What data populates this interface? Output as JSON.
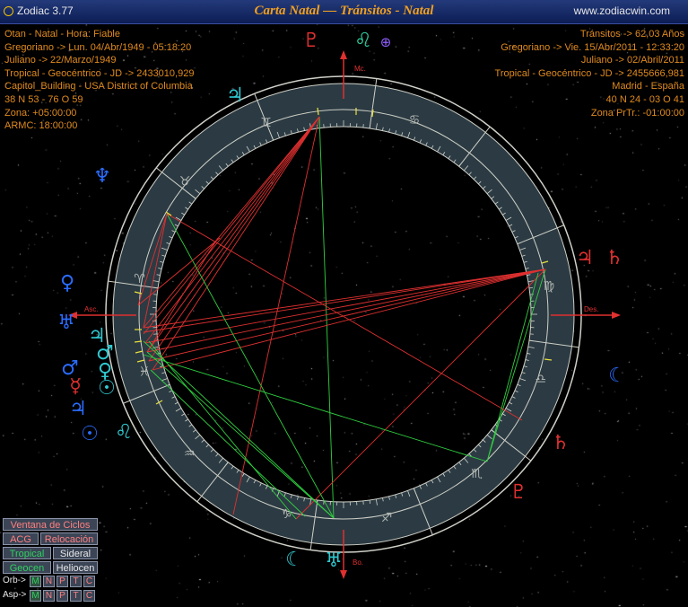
{
  "titlebar": {
    "app_name": "Zodiac 3.77",
    "title": "Carta Natal — Tránsitos - Natal",
    "website": "www.zodiacwin.com"
  },
  "natal_info": [
    "Otan - Natal - Hora: Fiable",
    "Gregoriano -> Lun. 04/Abr/1949 - 05:18:20",
    "Juliano -> 22/Marzo/1949",
    "Tropical - Geocéntrico - JD -> 2433010,929",
    "Capitol_Building - USA District of Columbia",
    "38 N 53 - 76 O 59",
    "Zona: +05:00:00",
    "ARMC: 18:00:00"
  ],
  "transit_info": [
    "Tránsitos -> 62,03 Años",
    "Gregoriano -> Vie. 15/Abr/2011 - 12:33:20",
    "Juliano -> 02/Abril/2011",
    "Tropical - Geocéntrico - JD -> 2455666,981",
    "Madrid - España",
    "40 N 24 - 03 O 41",
    "Zona PrTr.: -01:00:00"
  ],
  "wheel_labels": {
    "mc": "Mc.",
    "asc": "Asc.",
    "des": "Des.",
    "bo": "Bo."
  },
  "zodiac_signs": [
    "♈",
    "♉",
    "♊",
    "♋",
    "♌",
    "♍",
    "♎",
    "♏",
    "♐",
    "♑",
    "♒",
    "♓"
  ],
  "outer_glyphs": [
    {
      "glyph": "♆",
      "color": "#2a6cff"
    },
    {
      "glyph": "♄",
      "color": "#2a6cff"
    },
    {
      "glyph": "♀",
      "color": "#2a6cff"
    },
    {
      "glyph": "♅",
      "color": "#2a6cff"
    },
    {
      "glyph": "♂",
      "color": "#2a6cff"
    },
    {
      "glyph": "☿",
      "color": "#e03030"
    },
    {
      "glyph": "♃",
      "color": "#2a6cff"
    },
    {
      "glyph": "☉",
      "color": "#2a6cff"
    },
    {
      "glyph": "♃",
      "color": "#e03030"
    },
    {
      "glyph": "♄",
      "color": "#e03030"
    },
    {
      "glyph": "☾",
      "color": "#2a6cff"
    },
    {
      "glyph": "♄",
      "color": "#e03030"
    },
    {
      "glyph": "♇",
      "color": "#e03030"
    },
    {
      "glyph": "♇",
      "color": "#e03030"
    },
    {
      "glyph": "♌",
      "color": "#30d0a0"
    },
    {
      "glyph": "⊕",
      "color": "#9060ff"
    }
  ],
  "inner_glyphs": [
    {
      "glyph": "♃",
      "color": "#30c8d0"
    },
    {
      "glyph": "♅",
      "color": "#30c8d0"
    },
    {
      "glyph": "♂",
      "color": "#30c8d0"
    },
    {
      "glyph": "♀",
      "color": "#30c8d0"
    },
    {
      "glyph": "☉",
      "color": "#30c8d0"
    },
    {
      "glyph": "♌",
      "color": "#30c8d0"
    },
    {
      "glyph": "⊕",
      "color": "#e6e6e6"
    },
    {
      "glyph": "☾",
      "color": "#30c8d0"
    },
    {
      "glyph": "♅",
      "color": "#30c8d0"
    }
  ],
  "buttons": {
    "cycles": "Ventana de Ciclos",
    "acg": "ACG",
    "relocation": "Relocación",
    "tropical": "Tropical",
    "sidereal": "Sideral",
    "geocentric": "Geocen",
    "heliocentric": "Heliocen"
  },
  "orb_label": "Orb->",
  "asp_label": "Asp->",
  "planet_toggles": [
    "M",
    "N",
    "P",
    "T",
    "C"
  ],
  "colors": {
    "accent_orange": "#e08a1e",
    "wheel_band": "#2c3b43",
    "transit_red": "#e03030",
    "aspect_green": "#30d040",
    "natal_cyan": "#30c8d0"
  }
}
